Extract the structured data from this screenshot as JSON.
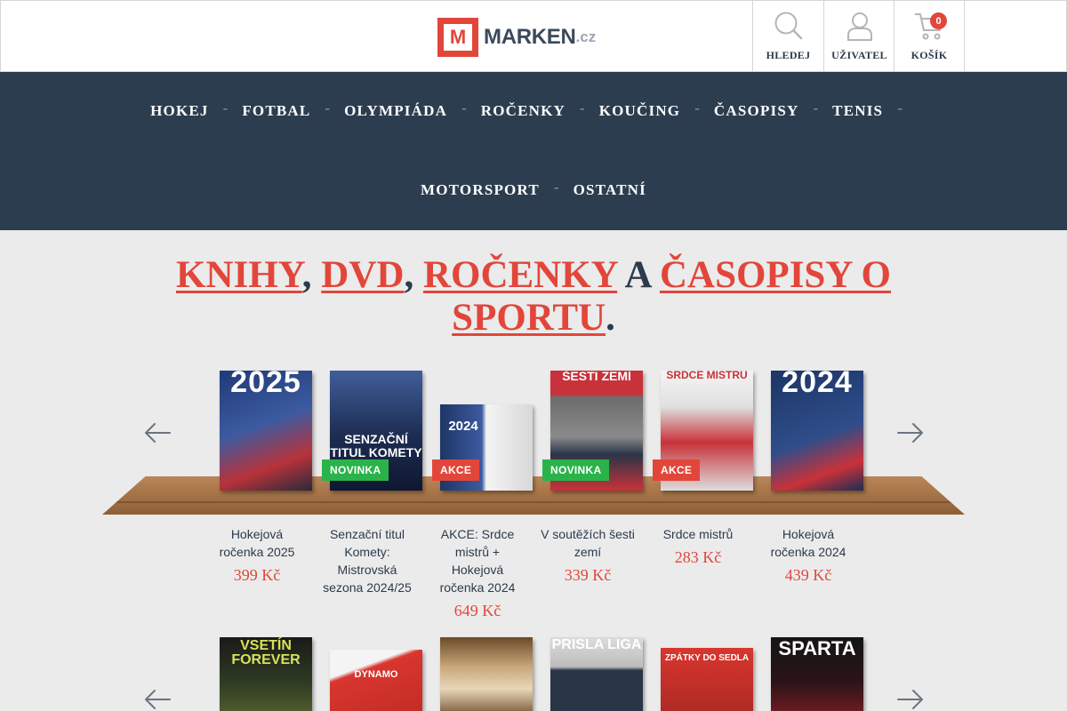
{
  "header": {
    "logo": {
      "letter": "M",
      "name": "MARKEN",
      "tld": ".cz"
    },
    "buttons": [
      {
        "label": "HLEDEJ",
        "icon": "search-icon"
      },
      {
        "label": "UŽIVATEL",
        "icon": "user-icon"
      },
      {
        "label": "KOŠÍK",
        "icon": "cart-icon",
        "count": "0"
      }
    ]
  },
  "nav": {
    "row1": [
      "HOKEJ",
      "FOTBAL",
      "OLYMPIÁDA",
      "ROČENKY",
      "KOUČING",
      "ČASOPISY",
      "TENIS"
    ],
    "row2": [
      "MOTORSPORT",
      "OSTATNÍ"
    ],
    "separator": "-"
  },
  "headline": {
    "links": [
      "KNIHY",
      "DVD",
      "ROČENKY",
      "ČASOPISY O SPORTU"
    ],
    "comma1": ", ",
    "comma2": ", ",
    "conj": " A ",
    "end": "."
  },
  "products": [
    {
      "name": "Hokejová ročenka 2025",
      "price": "399 Kč",
      "badge": "",
      "cover_text": "2025"
    },
    {
      "name": "Senzační titul Komety: Mistrovská sezona 2024/25",
      "price": "",
      "badge": "NOVINKA",
      "cover_text": "SENZAČNÍ TITUL KOMETY"
    },
    {
      "name": "AKCE: Srdce mistrů + Hokejová ročenka 2024",
      "price": "649 Kč",
      "badge": "AKCE",
      "cover_text": "2024"
    },
    {
      "name": "V soutěžích šesti zemí",
      "price": "339 Kč",
      "badge": "NOVINKA",
      "cover_text": "ŠESTI ZEMÍ"
    },
    {
      "name": "Srdce mistrů",
      "price": "283 Kč",
      "badge": "AKCE",
      "cover_text": "SRDCE MISTRŮ"
    },
    {
      "name": "Hokejová ročenka 2024",
      "price": "439 Kč",
      "badge": "",
      "cover_text": "2024"
    }
  ],
  "row2_covers": [
    "VSETÍN FOREVER",
    "DYNAMO",
    "",
    "PRISLA LIGA",
    "ZPÁTKY DO SEDLA",
    "SPARTA"
  ],
  "colors": {
    "accent": "#e2463a",
    "nav_bg": "#2d3d50",
    "badge_green": "#2ab34a",
    "text_dark": "#2c3a4b"
  }
}
